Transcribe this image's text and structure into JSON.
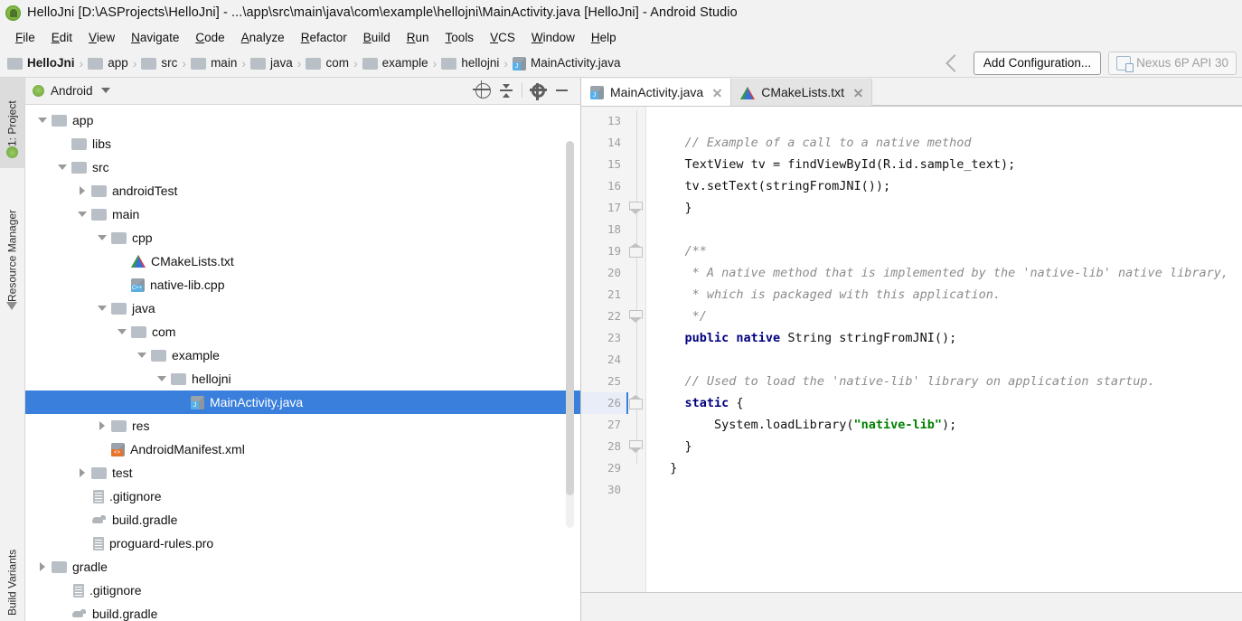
{
  "window": {
    "title": "HelloJni [D:\\ASProjects\\HelloJni] - ...\\app\\src\\main\\java\\com\\example\\hellojni\\MainActivity.java [HelloJni] - Android Studio",
    "logo_icon": "android-studio-logo"
  },
  "menubar": {
    "items": [
      {
        "label": "File"
      },
      {
        "label": "Edit"
      },
      {
        "label": "View"
      },
      {
        "label": "Navigate"
      },
      {
        "label": "Code"
      },
      {
        "label": "Analyze"
      },
      {
        "label": "Refactor"
      },
      {
        "label": "Build"
      },
      {
        "label": "Run"
      },
      {
        "label": "Tools"
      },
      {
        "label": "VCS"
      },
      {
        "label": "Window"
      },
      {
        "label": "Help"
      }
    ]
  },
  "navbar": {
    "crumbs": [
      {
        "label": "HelloJni",
        "icon": "module-icon"
      },
      {
        "label": "app",
        "icon": "folder-icon"
      },
      {
        "label": "src",
        "icon": "folder-icon"
      },
      {
        "label": "main",
        "icon": "folder-icon"
      },
      {
        "label": "java",
        "icon": "folder-icon"
      },
      {
        "label": "com",
        "icon": "folder-icon"
      },
      {
        "label": "example",
        "icon": "folder-icon"
      },
      {
        "label": "hellojni",
        "icon": "folder-icon"
      },
      {
        "label": "MainActivity.java",
        "icon": "java-file-icon"
      }
    ],
    "separator": "›",
    "back_icon": "back-arrow-icon",
    "add_configuration_label": "Add Configuration...",
    "device_label": "Nexus 6P API 30",
    "device_icon": "device-icon"
  },
  "toolstrip": {
    "tabs": [
      {
        "label": "1: Project",
        "icon": "android-icon",
        "active": true
      },
      {
        "label": "Resource Manager",
        "icon": "resource-manager-icon",
        "active": false
      },
      {
        "label": "Build Variants",
        "icon": "build-variants-icon",
        "active": false
      }
    ]
  },
  "project_panel": {
    "header": {
      "title": "Android",
      "android_icon": "android-icon",
      "dropdown_icon": "chevron-down-icon",
      "actions": [
        {
          "name": "locate-icon",
          "title": "Select Opened File"
        },
        {
          "name": "collapse-all-icon",
          "title": "Collapse All"
        },
        {
          "name": "gear-icon",
          "title": "Settings"
        },
        {
          "name": "minimize-icon",
          "title": "Hide"
        }
      ]
    },
    "tree": [
      {
        "label": "app",
        "icon": "folder-icon",
        "arrow": "down",
        "depth": 1,
        "selected": false
      },
      {
        "label": "libs",
        "icon": "folder-icon",
        "arrow": "none",
        "depth": 2,
        "selected": false
      },
      {
        "label": "src",
        "icon": "folder-icon",
        "arrow": "down",
        "depth": 2,
        "selected": false
      },
      {
        "label": "androidTest",
        "icon": "folder-icon",
        "arrow": "right",
        "depth": 3,
        "selected": false
      },
      {
        "label": "main",
        "icon": "folder-icon",
        "arrow": "down",
        "depth": 3,
        "selected": false
      },
      {
        "label": "cpp",
        "icon": "folder-icon",
        "arrow": "down",
        "depth": 4,
        "selected": false
      },
      {
        "label": "CMakeLists.txt",
        "icon": "cmake-file-icon",
        "arrow": "none",
        "depth": 5,
        "selected": false
      },
      {
        "label": "native-lib.cpp",
        "icon": "cpp-file-icon",
        "arrow": "none",
        "depth": 5,
        "selected": false
      },
      {
        "label": "java",
        "icon": "folder-icon",
        "arrow": "down",
        "depth": 4,
        "selected": false
      },
      {
        "label": "com",
        "icon": "folder-icon",
        "arrow": "down",
        "depth": 5,
        "selected": false
      },
      {
        "label": "example",
        "icon": "folder-icon",
        "arrow": "down",
        "depth": 6,
        "selected": false
      },
      {
        "label": "hellojni",
        "icon": "folder-icon",
        "arrow": "down",
        "depth": 7,
        "selected": false
      },
      {
        "label": "MainActivity.java",
        "icon": "java-file-icon",
        "arrow": "none",
        "depth": 8,
        "selected": true
      },
      {
        "label": "res",
        "icon": "folder-icon",
        "arrow": "right",
        "depth": 4,
        "selected": false
      },
      {
        "label": "AndroidManifest.xml",
        "icon": "xml-file-icon",
        "arrow": "none",
        "depth": 4,
        "selected": false
      },
      {
        "label": "test",
        "icon": "folder-icon",
        "arrow": "right",
        "depth": 3,
        "selected": false
      },
      {
        "label": ".gitignore",
        "icon": "text-file-icon",
        "arrow": "none",
        "depth": 3,
        "selected": false
      },
      {
        "label": "build.gradle",
        "icon": "gradle-file-icon",
        "arrow": "none",
        "depth": 3,
        "selected": false
      },
      {
        "label": "proguard-rules.pro",
        "icon": "text-file-icon",
        "arrow": "none",
        "depth": 3,
        "selected": false
      },
      {
        "label": "gradle",
        "icon": "folder-icon",
        "arrow": "right",
        "depth": 1,
        "selected": false
      },
      {
        "label": ".gitignore",
        "icon": "text-file-icon",
        "arrow": "none",
        "depth": 2,
        "selected": false
      },
      {
        "label": "build.gradle",
        "icon": "gradle-file-icon",
        "arrow": "none",
        "depth": 2,
        "selected": false
      }
    ]
  },
  "editor": {
    "tabs": [
      {
        "label": "MainActivity.java",
        "icon": "java-file-icon",
        "active": true,
        "close_icon": "close-icon"
      },
      {
        "label": "CMakeLists.txt",
        "icon": "cmake-file-icon",
        "active": false,
        "close_icon": "close-icon"
      }
    ],
    "first_line_number": 13,
    "current_line": 26,
    "lines": [
      {
        "n": 13,
        "indent": 0,
        "tokens": [],
        "fold": "none"
      },
      {
        "n": 14,
        "indent": 2,
        "tokens": [
          {
            "t": "// Example of a call to a native method",
            "c": "cmt"
          }
        ],
        "fold": "none"
      },
      {
        "n": 15,
        "indent": 2,
        "tokens": [
          {
            "t": "TextView tv = findViewById(R.id.sample_text);",
            "c": "txt"
          }
        ],
        "fold": "none"
      },
      {
        "n": 16,
        "indent": 2,
        "tokens": [
          {
            "t": "tv.setText(stringFromJNI());",
            "c": "txt"
          }
        ],
        "fold": "none"
      },
      {
        "n": 17,
        "indent": 2,
        "tokens": [
          {
            "t": "}",
            "c": "txt"
          }
        ],
        "fold": "close"
      },
      {
        "n": 18,
        "indent": 0,
        "tokens": [],
        "fold": "none"
      },
      {
        "n": 19,
        "indent": 2,
        "tokens": [
          {
            "t": "/**",
            "c": "cmt"
          }
        ],
        "fold": "open"
      },
      {
        "n": 20,
        "indent": 2,
        "tokens": [
          {
            "t": " * A native method that is implemented by the 'native-lib' native library,",
            "c": "cmt"
          }
        ],
        "fold": "none"
      },
      {
        "n": 21,
        "indent": 2,
        "tokens": [
          {
            "t": " * which is packaged with this application.",
            "c": "cmt"
          }
        ],
        "fold": "none"
      },
      {
        "n": 22,
        "indent": 2,
        "tokens": [
          {
            "t": " */",
            "c": "cmt"
          }
        ],
        "fold": "close"
      },
      {
        "n": 23,
        "indent": 2,
        "tokens": [
          {
            "t": "public native",
            "c": "kw"
          },
          {
            "t": " String stringFromJNI();",
            "c": "txt"
          }
        ],
        "fold": "none"
      },
      {
        "n": 24,
        "indent": 0,
        "tokens": [],
        "fold": "none"
      },
      {
        "n": 25,
        "indent": 2,
        "tokens": [
          {
            "t": "// Used to load the 'native-lib' library on application startup.",
            "c": "cmt"
          }
        ],
        "fold": "none"
      },
      {
        "n": 26,
        "indent": 2,
        "tokens": [
          {
            "t": "static",
            "c": "kw"
          },
          {
            "t": " {",
            "c": "txt"
          }
        ],
        "fold": "open"
      },
      {
        "n": 27,
        "indent": 4,
        "tokens": [
          {
            "t": "System.loadLibrary(",
            "c": "txt"
          },
          {
            "t": "\"native-lib\"",
            "c": "str"
          },
          {
            "t": ");",
            "c": "txt"
          }
        ],
        "fold": "none"
      },
      {
        "n": 28,
        "indent": 2,
        "tokens": [
          {
            "t": "}",
            "c": "txt"
          }
        ],
        "fold": "close"
      },
      {
        "n": 29,
        "indent": 1,
        "tokens": [
          {
            "t": "}",
            "c": "txt"
          }
        ],
        "fold": "none"
      },
      {
        "n": 30,
        "indent": 0,
        "tokens": [],
        "fold": "none"
      }
    ]
  },
  "colors": {
    "selection_blue": "#3a7fdc",
    "keyword": "#000080",
    "string": "#008000",
    "comment": "#8c8c8c",
    "chrome": "#f2f2f2"
  }
}
